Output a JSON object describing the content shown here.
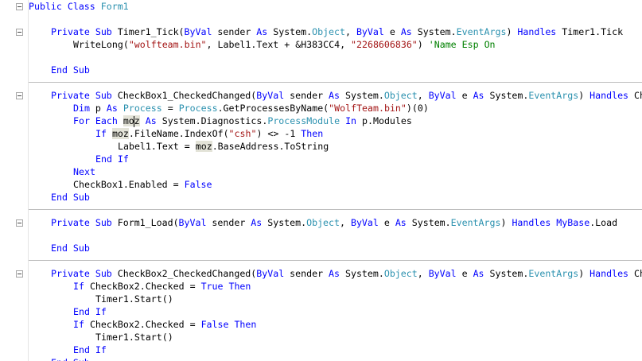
{
  "editor": {
    "lines": [
      {
        "indent": 0,
        "tokens": [
          {
            "t": "Public Class ",
            "c": "kw"
          },
          {
            "t": "Form1",
            "c": "ty"
          }
        ]
      },
      {
        "indent": 0,
        "tokens": []
      },
      {
        "indent": 1,
        "tokens": [
          {
            "t": "Private Sub ",
            "c": "kw"
          },
          {
            "t": "Timer1_Tick("
          },
          {
            "t": "ByVal",
            "c": "kw"
          },
          {
            "t": " sender "
          },
          {
            "t": "As",
            "c": "kw"
          },
          {
            "t": " System."
          },
          {
            "t": "Object",
            "c": "ty"
          },
          {
            "t": ", "
          },
          {
            "t": "ByVal",
            "c": "kw"
          },
          {
            "t": " e "
          },
          {
            "t": "As",
            "c": "kw"
          },
          {
            "t": " System."
          },
          {
            "t": "EventArgs",
            "c": "ty"
          },
          {
            "t": ") "
          },
          {
            "t": "Handles",
            "c": "kw"
          },
          {
            "t": " Timer1.Tick"
          }
        ]
      },
      {
        "indent": 2,
        "tokens": [
          {
            "t": "WriteLong("
          },
          {
            "t": "\"wolfteam.bin\"",
            "c": "st"
          },
          {
            "t": ", Label1.Text + &H383CC4, "
          },
          {
            "t": "\"2268606836\"",
            "c": "st"
          },
          {
            "t": ") "
          },
          {
            "t": "'Name Esp On",
            "c": "cm"
          }
        ]
      },
      {
        "indent": 0,
        "tokens": []
      },
      {
        "indent": 1,
        "tokens": [
          {
            "t": "End Sub",
            "c": "kw"
          }
        ]
      },
      {
        "indent": 0,
        "tokens": []
      },
      {
        "indent": 1,
        "tokens": [
          {
            "t": "Private Sub ",
            "c": "kw"
          },
          {
            "t": "CheckBox1_CheckedChanged("
          },
          {
            "t": "ByVal",
            "c": "kw"
          },
          {
            "t": " sender "
          },
          {
            "t": "As",
            "c": "kw"
          },
          {
            "t": " System."
          },
          {
            "t": "Object",
            "c": "ty"
          },
          {
            "t": ", "
          },
          {
            "t": "ByVal",
            "c": "kw"
          },
          {
            "t": " e "
          },
          {
            "t": "As",
            "c": "kw"
          },
          {
            "t": " System."
          },
          {
            "t": "EventArgs",
            "c": "ty"
          },
          {
            "t": ") "
          },
          {
            "t": "Handles",
            "c": "kw"
          },
          {
            "t": " Ch"
          }
        ]
      },
      {
        "indent": 2,
        "tokens": [
          {
            "t": "Dim",
            "c": "kw"
          },
          {
            "t": " p "
          },
          {
            "t": "As",
            "c": "kw"
          },
          {
            "t": " "
          },
          {
            "t": "Process",
            "c": "ty"
          },
          {
            "t": " = "
          },
          {
            "t": "Process",
            "c": "ty"
          },
          {
            "t": ".GetProcessesByName("
          },
          {
            "t": "\"WolfTeam.bin\"",
            "c": "st"
          },
          {
            "t": ")(0)"
          }
        ]
      },
      {
        "indent": 2,
        "tokens": [
          {
            "t": "For Each",
            "c": "kw"
          },
          {
            "t": " "
          },
          {
            "t": "mo",
            "c": "hl"
          },
          {
            "t": "",
            "c": "caret"
          },
          {
            "t": "z",
            "c": "hl"
          },
          {
            "t": " "
          },
          {
            "t": "As",
            "c": "kw"
          },
          {
            "t": " System.Diagnostics."
          },
          {
            "t": "ProcessModule",
            "c": "ty"
          },
          {
            "t": " "
          },
          {
            "t": "In",
            "c": "kw"
          },
          {
            "t": " p.Modules"
          }
        ]
      },
      {
        "indent": 3,
        "tokens": [
          {
            "t": "If",
            "c": "kw"
          },
          {
            "t": " "
          },
          {
            "t": "moz",
            "c": "hl"
          },
          {
            "t": ".FileName.IndexOf("
          },
          {
            "t": "\"csh\"",
            "c": "st"
          },
          {
            "t": ") <> -1 "
          },
          {
            "t": "Then",
            "c": "kw"
          }
        ]
      },
      {
        "indent": 4,
        "tokens": [
          {
            "t": "Label1.Text = "
          },
          {
            "t": "moz",
            "c": "hl"
          },
          {
            "t": ".BaseAddress.ToString"
          }
        ]
      },
      {
        "indent": 3,
        "tokens": [
          {
            "t": "End If",
            "c": "kw"
          }
        ]
      },
      {
        "indent": 2,
        "tokens": [
          {
            "t": "Next",
            "c": "kw"
          }
        ]
      },
      {
        "indent": 2,
        "tokens": [
          {
            "t": "CheckBox1.Enabled = "
          },
          {
            "t": "False",
            "c": "kw"
          }
        ]
      },
      {
        "indent": 1,
        "tokens": [
          {
            "t": "End Sub",
            "c": "kw"
          }
        ]
      },
      {
        "indent": 0,
        "tokens": []
      },
      {
        "indent": 1,
        "tokens": [
          {
            "t": "Private Sub ",
            "c": "kw"
          },
          {
            "t": "Form1_Load("
          },
          {
            "t": "ByVal",
            "c": "kw"
          },
          {
            "t": " sender "
          },
          {
            "t": "As",
            "c": "kw"
          },
          {
            "t": " System."
          },
          {
            "t": "Object",
            "c": "ty"
          },
          {
            "t": ", "
          },
          {
            "t": "ByVal",
            "c": "kw"
          },
          {
            "t": " e "
          },
          {
            "t": "As",
            "c": "kw"
          },
          {
            "t": " System."
          },
          {
            "t": "EventArgs",
            "c": "ty"
          },
          {
            "t": ") "
          },
          {
            "t": "Handles",
            "c": "kw"
          },
          {
            "t": " "
          },
          {
            "t": "MyBase",
            "c": "kw"
          },
          {
            "t": ".Load"
          }
        ]
      },
      {
        "indent": 0,
        "tokens": []
      },
      {
        "indent": 1,
        "tokens": [
          {
            "t": "End Sub",
            "c": "kw"
          }
        ]
      },
      {
        "indent": 0,
        "tokens": []
      },
      {
        "indent": 1,
        "tokens": [
          {
            "t": "Private Sub ",
            "c": "kw"
          },
          {
            "t": "CheckBox2_CheckedChanged("
          },
          {
            "t": "ByVal",
            "c": "kw"
          },
          {
            "t": " sender "
          },
          {
            "t": "As",
            "c": "kw"
          },
          {
            "t": " System."
          },
          {
            "t": "Object",
            "c": "ty"
          },
          {
            "t": ", "
          },
          {
            "t": "ByVal",
            "c": "kw"
          },
          {
            "t": " e "
          },
          {
            "t": "As",
            "c": "kw"
          },
          {
            "t": " System."
          },
          {
            "t": "EventArgs",
            "c": "ty"
          },
          {
            "t": ") "
          },
          {
            "t": "Handles",
            "c": "kw"
          },
          {
            "t": " Ch"
          }
        ]
      },
      {
        "indent": 2,
        "tokens": [
          {
            "t": "If",
            "c": "kw"
          },
          {
            "t": " CheckBox2.Checked = "
          },
          {
            "t": "True",
            "c": "kw"
          },
          {
            "t": " "
          },
          {
            "t": "Then",
            "c": "kw"
          }
        ]
      },
      {
        "indent": 3,
        "tokens": [
          {
            "t": "Timer1.Start()"
          }
        ]
      },
      {
        "indent": 2,
        "tokens": [
          {
            "t": "End If",
            "c": "kw"
          }
        ]
      },
      {
        "indent": 2,
        "tokens": [
          {
            "t": "If",
            "c": "kw"
          },
          {
            "t": " CheckBox2.Checked = "
          },
          {
            "t": "False",
            "c": "kw"
          },
          {
            "t": " "
          },
          {
            "t": "Then",
            "c": "kw"
          }
        ]
      },
      {
        "indent": 3,
        "tokens": [
          {
            "t": "Timer1.Start()"
          }
        ]
      },
      {
        "indent": 2,
        "tokens": [
          {
            "t": "End If",
            "c": "kw"
          }
        ]
      },
      {
        "indent": 1,
        "tokens": [
          {
            "t": "End Sub",
            "c": "kw"
          }
        ]
      }
    ],
    "fold_lines": [
      0,
      2,
      7,
      17,
      21
    ],
    "separator_after_lines": [
      5,
      15,
      19
    ],
    "colors": {
      "keyword": "#0000ff",
      "type": "#2b91af",
      "string": "#a31515",
      "comment": "#008000",
      "highlight": "#e3e3d8"
    }
  }
}
